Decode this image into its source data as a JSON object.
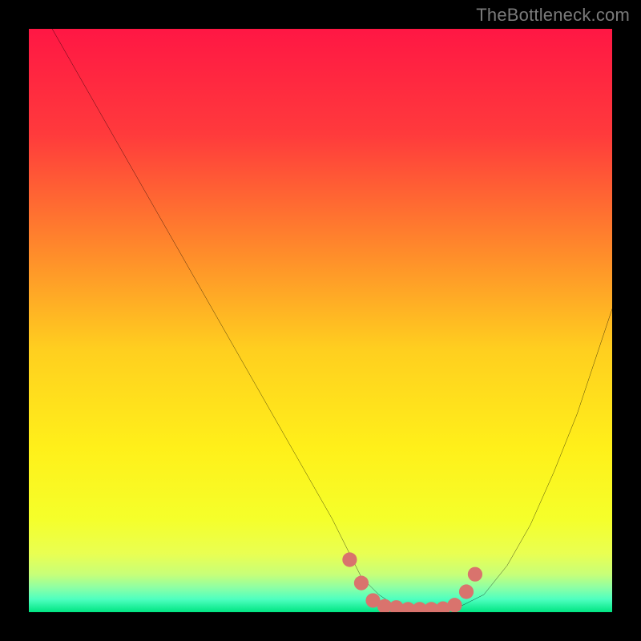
{
  "watermark": "TheBottleneck.com",
  "colors": {
    "frame": "#000000",
    "watermark_text": "#7a7a7a",
    "curve": "#000000",
    "marker_fill": "#d9736d",
    "gradient_stops": [
      {
        "offset": 0,
        "color": "#ff1744"
      },
      {
        "offset": 0.18,
        "color": "#ff3a3c"
      },
      {
        "offset": 0.38,
        "color": "#ff8a2b"
      },
      {
        "offset": 0.55,
        "color": "#ffcf1f"
      },
      {
        "offset": 0.72,
        "color": "#fff01a"
      },
      {
        "offset": 0.84,
        "color": "#f5ff2a"
      },
      {
        "offset": 0.9,
        "color": "#e9ff52"
      },
      {
        "offset": 0.935,
        "color": "#c8ff78"
      },
      {
        "offset": 0.958,
        "color": "#8dffa5"
      },
      {
        "offset": 0.978,
        "color": "#4effc0"
      },
      {
        "offset": 1.0,
        "color": "#00e582"
      }
    ]
  },
  "chart_data": {
    "type": "line",
    "title": "",
    "xlabel": "",
    "ylabel": "",
    "xlim": [
      0,
      100
    ],
    "ylim": [
      0,
      100
    ],
    "grid": false,
    "legend": false,
    "series": [
      {
        "name": "bottleneck-curve",
        "x": [
          4,
          8,
          12,
          16,
          20,
          24,
          28,
          32,
          36,
          40,
          44,
          48,
          52,
          55,
          57,
          60,
          63,
          66,
          70,
          74,
          78,
          82,
          86,
          90,
          94,
          98,
          100
        ],
        "y": [
          100,
          93,
          86,
          79,
          72,
          65,
          58,
          51,
          44,
          37,
          30,
          23,
          16,
          10,
          6,
          3,
          1,
          0.5,
          0.5,
          1,
          3,
          8,
          15,
          24,
          34,
          46,
          52
        ]
      }
    ],
    "markers": [
      {
        "x": 55,
        "y": 9
      },
      {
        "x": 57,
        "y": 5
      },
      {
        "x": 59,
        "y": 2
      },
      {
        "x": 61,
        "y": 1
      },
      {
        "x": 63,
        "y": 0.8
      },
      {
        "x": 65,
        "y": 0.5
      },
      {
        "x": 67,
        "y": 0.5
      },
      {
        "x": 69,
        "y": 0.5
      },
      {
        "x": 71,
        "y": 0.6
      },
      {
        "x": 73,
        "y": 1.2
      },
      {
        "x": 75,
        "y": 3.5
      },
      {
        "x": 76.5,
        "y": 6.5
      }
    ]
  }
}
